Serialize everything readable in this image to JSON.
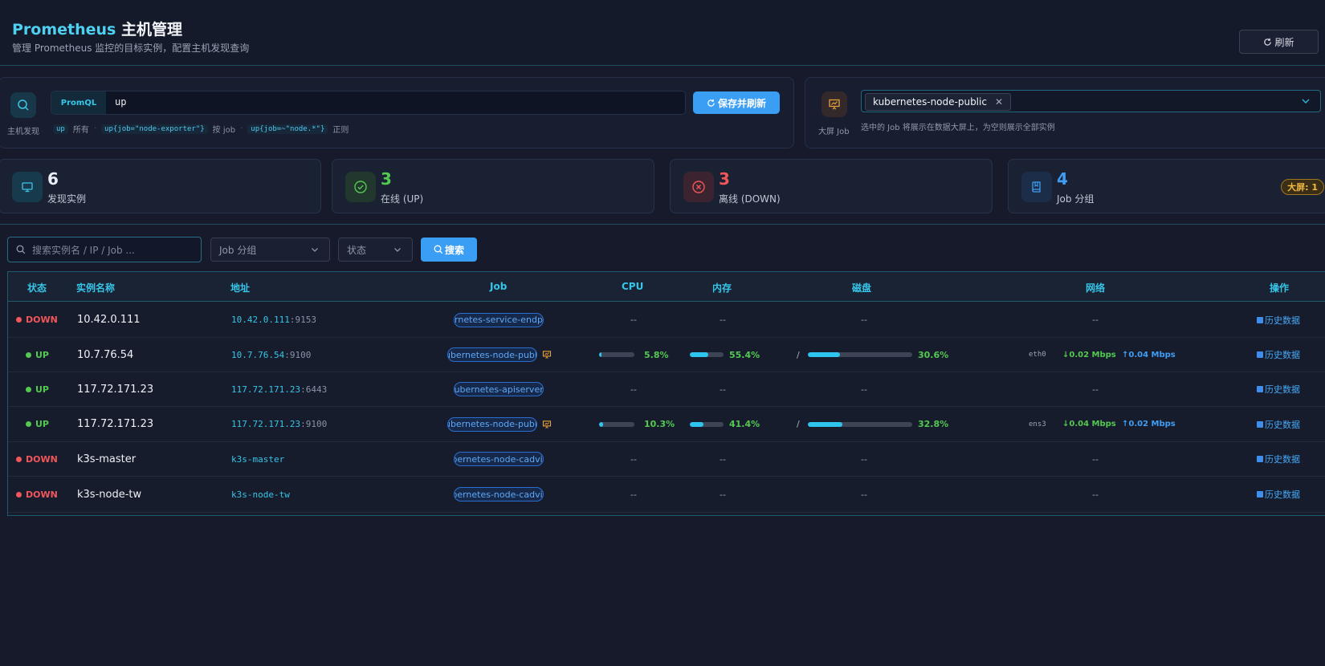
{
  "header": {
    "title_brand": "Prometheus",
    "title_rest": "主机管理",
    "subtitle": "管理 Prometheus 监控的目标实例，配置主机发现查询",
    "refresh_label": "刷新"
  },
  "query": {
    "icon_label": "主机发现",
    "tag": "PromQL",
    "value": "up",
    "save_label": "保存并刷新",
    "hints": [
      {
        "code": "up",
        "text": "所有"
      },
      {
        "code": "up{job=\"node-exporter\"}",
        "text": "按 job"
      },
      {
        "code": "up{job=~\"node.*\"}",
        "text": "正则"
      }
    ]
  },
  "bigscreen": {
    "icon_label": "大屏 Job",
    "selected_job": "kubernetes-node-public",
    "description": "选中的 Job 将展示在数据大屏上，为空则展示全部实例"
  },
  "stats": [
    {
      "value": "6",
      "label": "发现实例",
      "color": "#e9edf4"
    },
    {
      "value": "3",
      "label": "在线 (UP)",
      "color": "#53c950"
    },
    {
      "value": "3",
      "label": "离线 (DOWN)",
      "color": "#f0565a"
    },
    {
      "value": "4",
      "label": "Job 分组",
      "color": "#3f9ef4",
      "badge": "大屏: 1"
    }
  ],
  "filters": {
    "search_placeholder": "搜索实例名 / IP / Job ...",
    "job_placeholder": "Job 分组",
    "status_placeholder": "状态",
    "search_label": "搜索"
  },
  "table": {
    "columns": [
      "状态",
      "实例名称",
      "地址",
      "Job",
      "CPU",
      "内存",
      "磁盘",
      "网络",
      "操作"
    ],
    "rows": [
      {
        "status": "DOWN",
        "name": "10.42.0.111",
        "host": "10.42.0.111",
        "port": ":9153",
        "job": "kubernetes-service-endpoints",
        "cpu": "--",
        "mem": "--",
        "disk": "--",
        "net": "--",
        "action": "历史数据"
      },
      {
        "status": "UP",
        "name": "10.7.76.54",
        "host": "10.7.76.54",
        "port": ":9100",
        "job": "kubernetes-node-public",
        "bigscreen": true,
        "cpu": "5.8%",
        "cpu_value": 5.8,
        "mem": "55.4%",
        "mem_value": 55.4,
        "disk_mount": "/",
        "disk": "30.6%",
        "disk_value": 30.6,
        "iface": "eth0",
        "net_down": "↓0.02 Mbps",
        "net_up": "↑0.04 Mbps",
        "action": "历史数据"
      },
      {
        "status": "UP",
        "name": "117.72.171.23",
        "host": "117.72.171.23",
        "port": ":6443",
        "job": "kubernetes-apiservers",
        "cpu": "--",
        "mem": "--",
        "disk": "--",
        "net": "--",
        "action": "历史数据"
      },
      {
        "status": "UP",
        "name": "117.72.171.23",
        "host": "117.72.171.23",
        "port": ":9100",
        "job": "kubernetes-node-public",
        "bigscreen": true,
        "cpu": "10.3%",
        "cpu_value": 10.3,
        "mem": "41.4%",
        "mem_value": 41.4,
        "disk_mount": "/",
        "disk": "32.8%",
        "disk_value": 32.8,
        "iface": "ens3",
        "net_down": "↓0.04 Mbps",
        "net_up": "↑0.02 Mbps",
        "action": "历史数据"
      },
      {
        "status": "DOWN",
        "name": "k3s-master",
        "host": "k3s-master",
        "port": "",
        "job": "kubernetes-node-cadvisor",
        "cpu": "--",
        "mem": "--",
        "disk": "--",
        "net": "--",
        "action": "历史数据"
      },
      {
        "status": "DOWN",
        "name": "k3s-node-tw",
        "host": "k3s-node-tw",
        "port": "",
        "job": "kubernetes-node-cadvisor",
        "cpu": "--",
        "mem": "--",
        "disk": "--",
        "net": "--",
        "action": "历史数据"
      }
    ]
  },
  "colors": {
    "accent": "#36c5e8",
    "primary": "#3b9ef5",
    "up": "#53c950",
    "down": "#f0565a",
    "warning": "#f3b941"
  },
  "icons": {
    "query": "search-icon",
    "bigscreen": "presentation-icon",
    "instances": "monitor-icon",
    "up": "check-circle-icon",
    "down": "x-circle-icon",
    "groups": "book-icon",
    "history": "chart-icon"
  }
}
